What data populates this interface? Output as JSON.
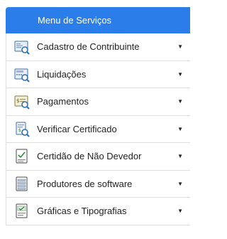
{
  "menu": {
    "title": "Menu de Serviços",
    "accent_color": "#2b7de9",
    "items": [
      {
        "label": "Cadastro de Contribuinte",
        "icon": "id-card-search-icon",
        "caret": "▼"
      },
      {
        "label": "Liquidações",
        "icon": "calculator-search-icon",
        "caret": "▼"
      },
      {
        "label": "Pagamentos",
        "icon": "money-search-icon",
        "caret": "▼"
      },
      {
        "label": "Verificar Certificado",
        "icon": "certificate-search-icon",
        "caret": "▼"
      },
      {
        "label": "Certidão de Não Devedor",
        "icon": "document-check-icon",
        "caret": "▼"
      },
      {
        "label": "Produtores de software",
        "icon": "server-list-icon",
        "caret": "▼"
      },
      {
        "label": "Gráficas e Tipografias",
        "icon": "print-check-icon",
        "caret": "▼"
      }
    ]
  }
}
